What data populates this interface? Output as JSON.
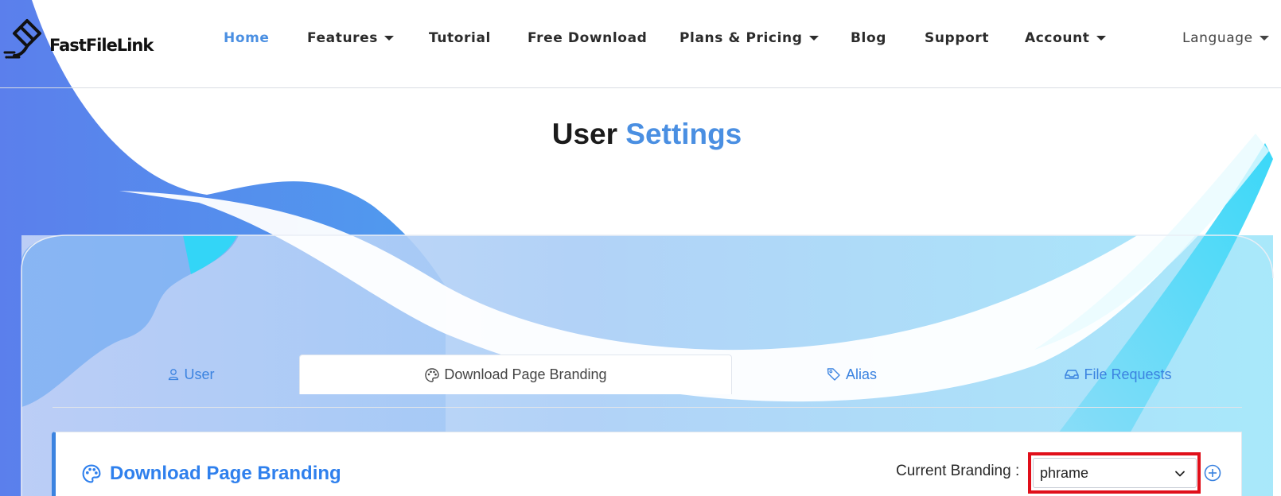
{
  "brand": {
    "name": "FastFileLink",
    "logo_icon": "file-upload-icon"
  },
  "nav": {
    "items": [
      {
        "label": "Home",
        "active": true,
        "dropdown": false
      },
      {
        "label": "Features",
        "active": false,
        "dropdown": true
      },
      {
        "label": "Tutorial",
        "active": false,
        "dropdown": false
      },
      {
        "label": "Free Download",
        "active": false,
        "dropdown": false
      },
      {
        "label": "Plans & Pricing",
        "active": false,
        "dropdown": true
      },
      {
        "label": "Blog",
        "active": false,
        "dropdown": false
      },
      {
        "label": "Support",
        "active": false,
        "dropdown": false
      },
      {
        "label": "Account",
        "active": false,
        "dropdown": true
      }
    ],
    "language": "Language"
  },
  "title": {
    "main": "User",
    "accent": "Settings"
  },
  "tabs": [
    {
      "label": "User",
      "icon": "user-icon",
      "active": false
    },
    {
      "label": "Download Page Branding",
      "icon": "palette-icon",
      "active": true
    },
    {
      "label": "Alias",
      "icon": "tag-icon",
      "active": false
    },
    {
      "label": "File Requests",
      "icon": "inbox-icon",
      "active": false
    }
  ],
  "section": {
    "title": "Download Page Branding",
    "icon": "palette-icon",
    "branding_label": "Current Branding :",
    "branding_value": "phrame",
    "add_icon": "plus-circle-icon"
  },
  "colors": {
    "accent": "#4a8fe2",
    "link": "#3b83e0",
    "highlight": "#e00f1a",
    "wave_dark": "#4f7fe8",
    "wave_cyan": "#3fd6f7"
  }
}
